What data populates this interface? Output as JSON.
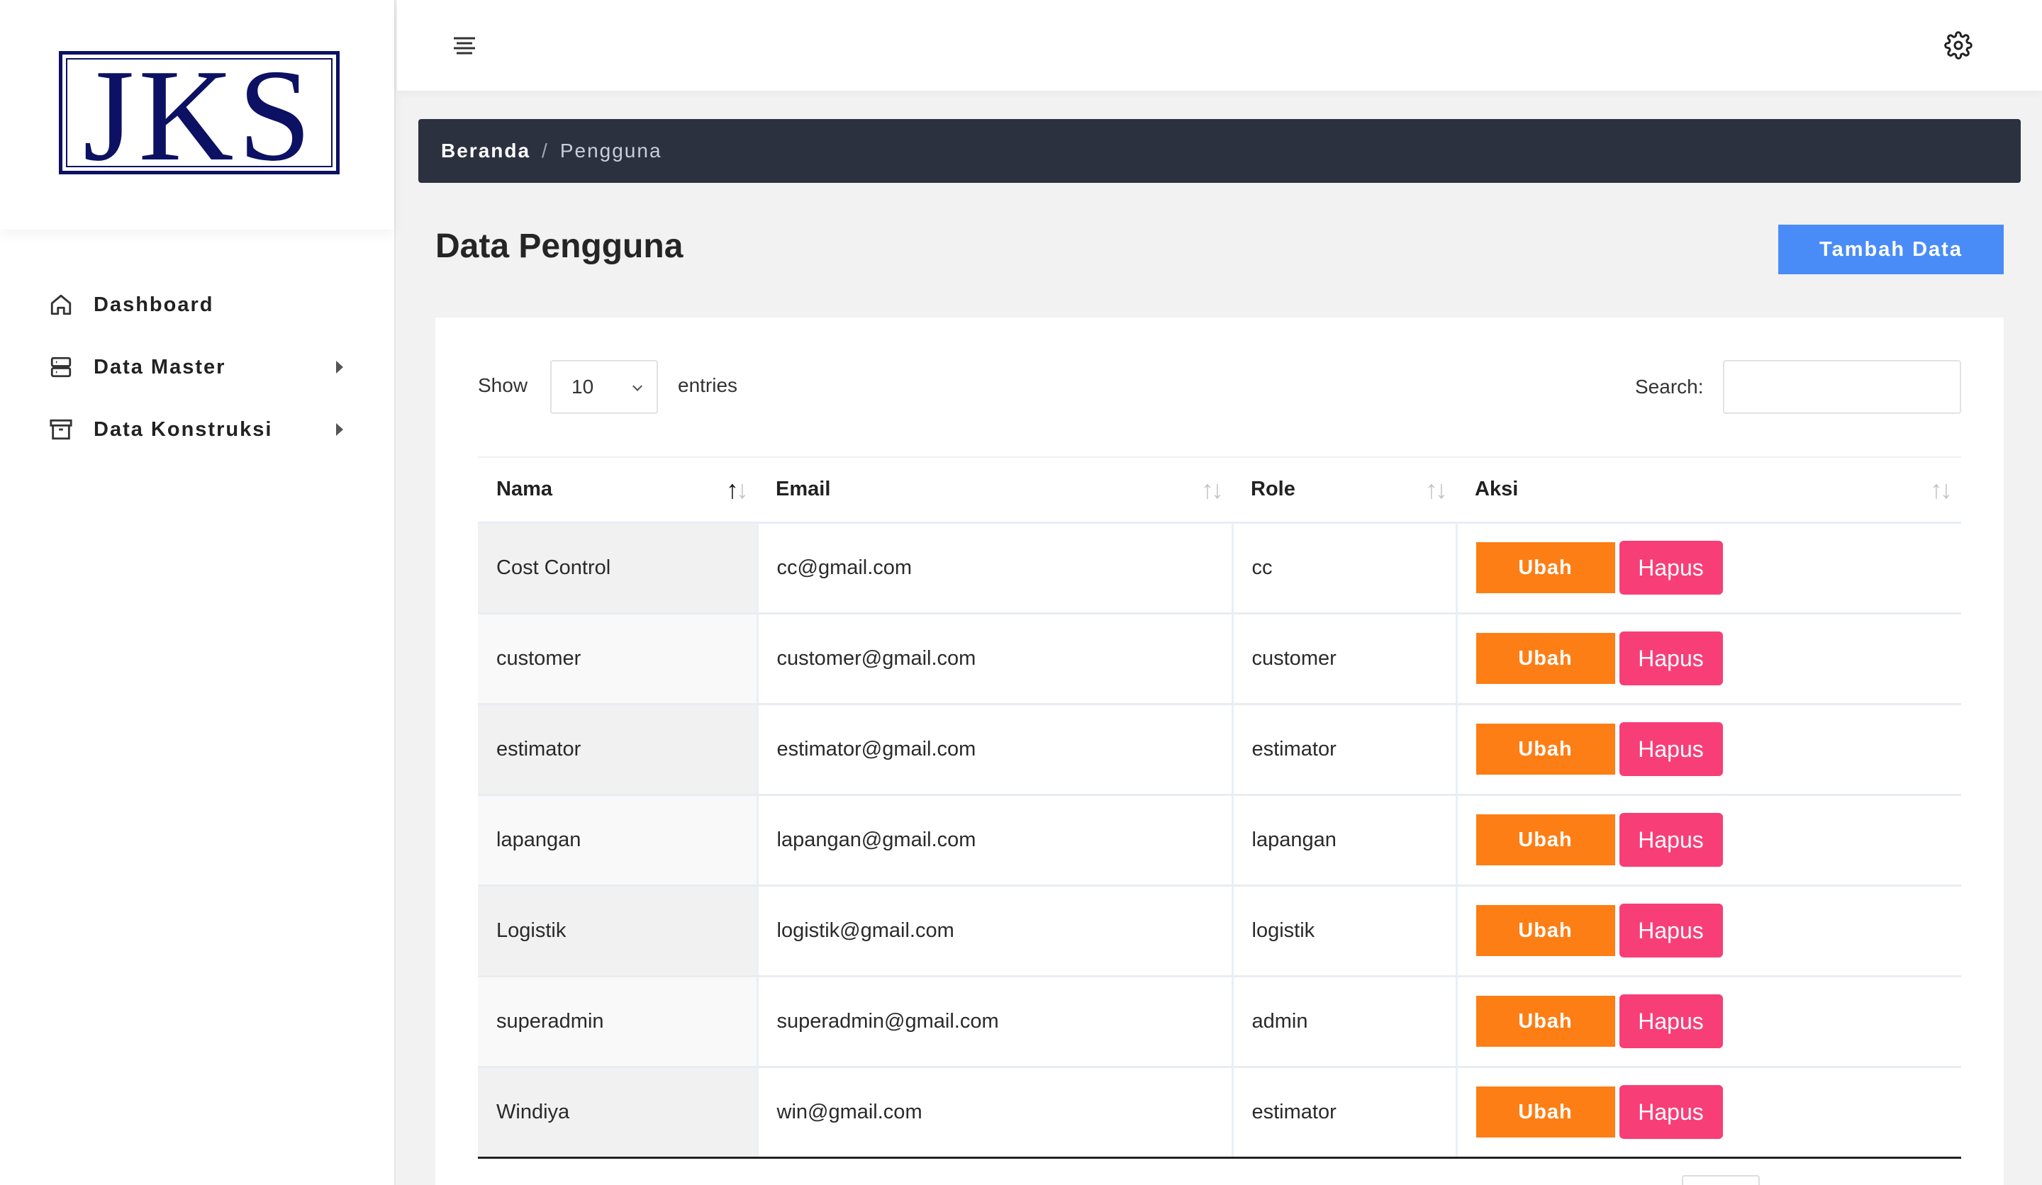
{
  "logo": {
    "text": "JKS"
  },
  "sidebar": {
    "items": [
      {
        "label": "Dashboard",
        "icon": "home-icon",
        "has_submenu": false
      },
      {
        "label": "Data Master",
        "icon": "server-icon",
        "has_submenu": true
      },
      {
        "label": "Data Konstruksi",
        "icon": "archive-icon",
        "has_submenu": true
      }
    ]
  },
  "topbar": {
    "menu_icon": "hamburger-icon",
    "settings_icon": "gear-icon"
  },
  "breadcrumb": {
    "home": "Beranda",
    "separator": "/",
    "current": "Pengguna"
  },
  "page": {
    "title": "Data Pengguna",
    "add_button": "Tambah Data"
  },
  "table_controls": {
    "show_label": "Show",
    "entries_value": "10",
    "entries_label": "entries",
    "search_label": "Search:",
    "search_value": ""
  },
  "table": {
    "columns": [
      "Nama",
      "Email",
      "Role",
      "Aksi"
    ],
    "sorted_column": "Nama",
    "rows": [
      {
        "nama": "Cost Control",
        "email": "cc@gmail.com",
        "role": "cc"
      },
      {
        "nama": "customer",
        "email": "customer@gmail.com",
        "role": "customer"
      },
      {
        "nama": "estimator",
        "email": "estimator@gmail.com",
        "role": "estimator"
      },
      {
        "nama": "lapangan",
        "email": "lapangan@gmail.com",
        "role": "lapangan"
      },
      {
        "nama": "Logistik",
        "email": "logistik@gmail.com",
        "role": "logistik"
      },
      {
        "nama": "superadmin",
        "email": "superadmin@gmail.com",
        "role": "admin"
      },
      {
        "nama": "Windiya",
        "email": "win@gmail.com",
        "role": "estimator"
      }
    ],
    "action_labels": {
      "edit": "Ubah",
      "delete": "Hapus"
    }
  },
  "colors": {
    "brand_navy": "#0d1163",
    "breadcrumb_bg": "#2c3140",
    "primary": "#4a8cf7",
    "edit": "#fd7e14",
    "delete": "#f83e77"
  }
}
